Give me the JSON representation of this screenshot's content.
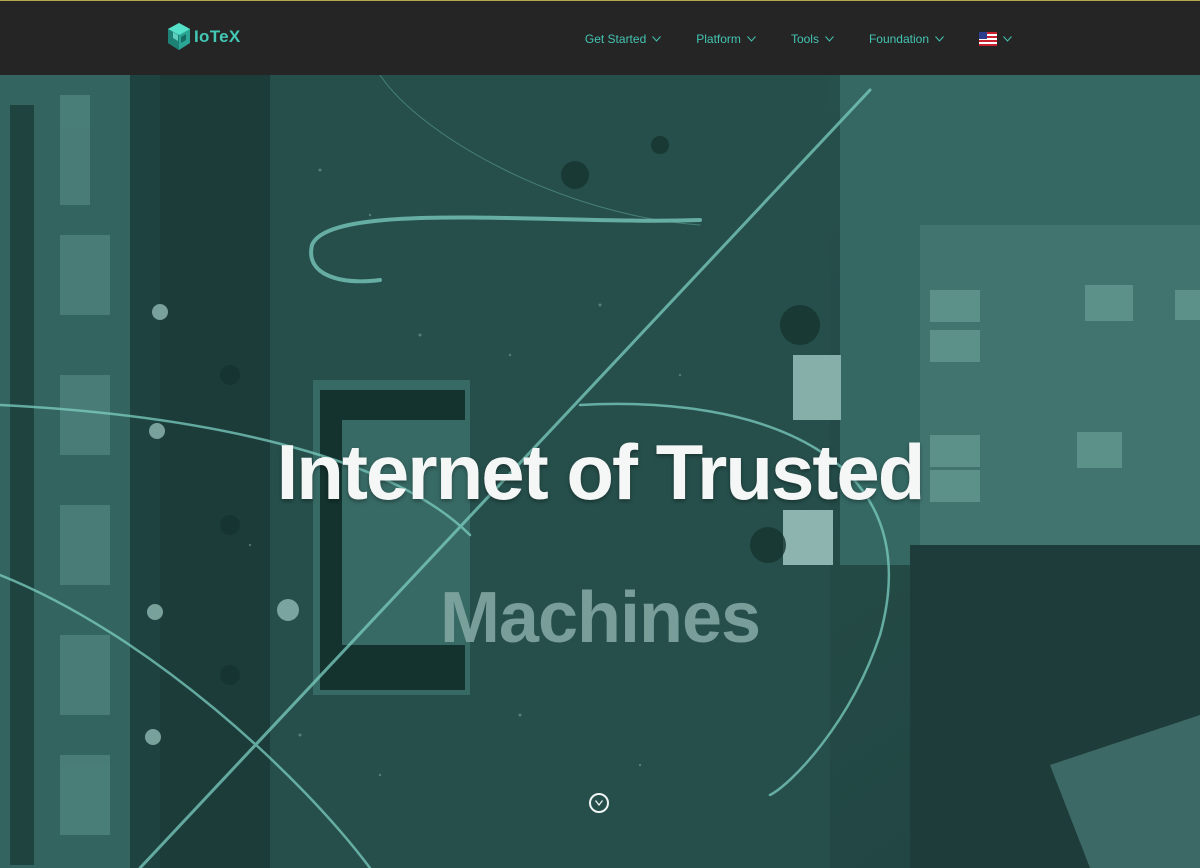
{
  "brand": {
    "logo_text": "IoTeX",
    "accent_color": "#42c8b5"
  },
  "nav": {
    "items": [
      {
        "label": "Get Started",
        "icon": "chevron-down-icon"
      },
      {
        "label": "Platform",
        "icon": "chevron-down-icon"
      },
      {
        "label": "Tools",
        "icon": "chevron-down-icon"
      },
      {
        "label": "Foundation",
        "icon": "chevron-down-icon"
      }
    ],
    "language": {
      "icon": "us-flag-icon"
    }
  },
  "hero": {
    "headline": "Internet of Trusted",
    "rotating_word": "Machines",
    "scroll_icon": "chevron-down-circle-icon"
  }
}
